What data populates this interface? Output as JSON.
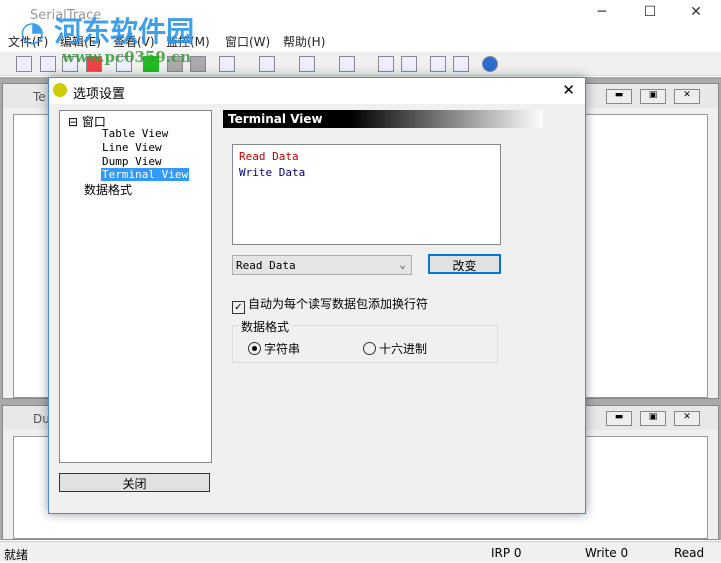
{
  "app": {
    "title": "SerialTrace"
  },
  "menu": [
    "文件(F)",
    "编辑(E)",
    "查看(V)",
    "监控(M)",
    "窗口(W)",
    "帮助(H)"
  ],
  "children": [
    {
      "title": "Te"
    },
    {
      "title": "Du"
    }
  ],
  "dialog": {
    "title": "选项设置",
    "tree": {
      "root": "窗口",
      "items": [
        "Table View",
        "Line View",
        "Dump View",
        "Terminal View"
      ],
      "other": "数据格式"
    },
    "header": "Terminal View",
    "preview": {
      "read": "Read Data",
      "write": "Write Data",
      "read_color": "#c00000",
      "write_color": "#000080"
    },
    "select_value": "Read Data",
    "change_label": "改变",
    "auto_newline_label": "自动为每个读写数据包添加换行符",
    "auto_newline_checked": true,
    "format_group": "数据格式",
    "radio_string": "字符串",
    "radio_hex": "十六进制",
    "selected": "string",
    "close_label": "关闭"
  },
  "status": {
    "ready": "就绪",
    "irp": "IRP 0",
    "write": "Write 0",
    "read": "Read"
  },
  "watermark": {
    "name": "河东软件园",
    "url": "www.pc0359.cn"
  }
}
